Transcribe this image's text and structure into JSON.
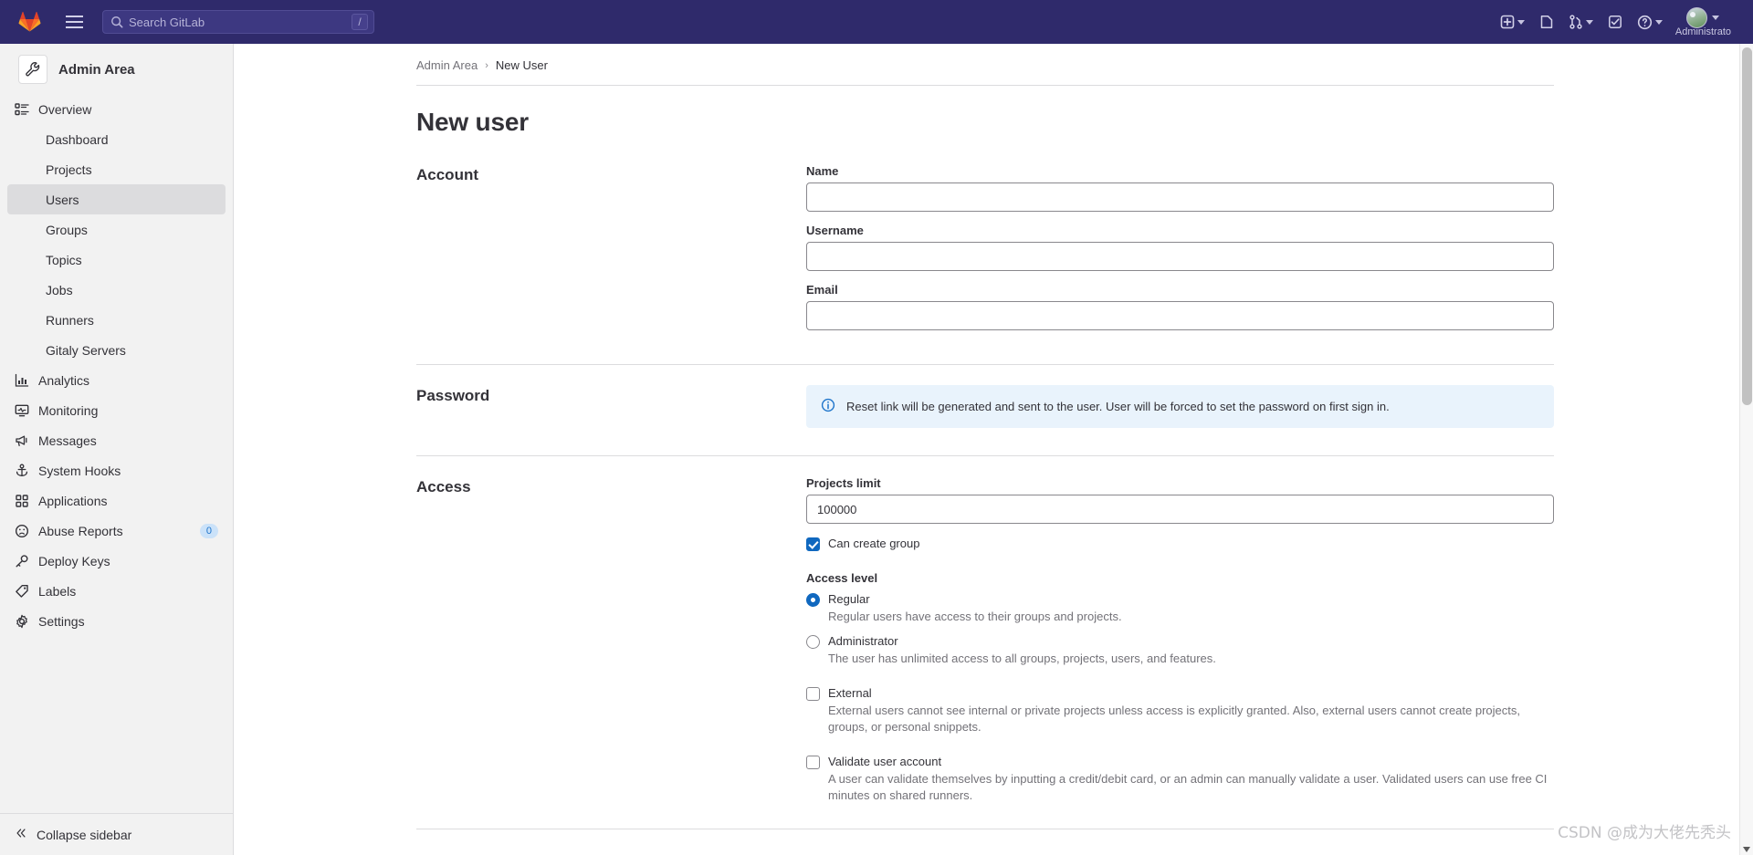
{
  "topbar": {
    "logo_icon": "gitlab-logo-icon",
    "menu_icon": "hamburger-menu-icon",
    "search": {
      "placeholder": "Search GitLab",
      "value": "",
      "shortcut_key": "/",
      "icon": "search-icon"
    },
    "actions": [
      {
        "name": "create-new-menu",
        "icon": "plus-square-icon",
        "has_caret": true
      },
      {
        "name": "issues-link",
        "icon": "issues-icon",
        "has_caret": false
      },
      {
        "name": "merge-requests-menu",
        "icon": "merge-request-icon",
        "has_caret": true
      },
      {
        "name": "todos-link",
        "icon": "todo-checkbox-icon",
        "has_caret": false
      },
      {
        "name": "help-menu",
        "icon": "question-circle-icon",
        "has_caret": true
      }
    ],
    "user": {
      "name": "Administrato",
      "avatar_icon": "user-avatar",
      "has_caret": true
    }
  },
  "sidebar": {
    "context": {
      "label": "Admin Area",
      "icon": "wrench-icon"
    },
    "items": [
      {
        "label": "Overview",
        "icon": "overview-list-icon",
        "level": "top",
        "active": false
      },
      {
        "label": "Dashboard",
        "icon": "",
        "level": "sub",
        "active": false
      },
      {
        "label": "Projects",
        "icon": "",
        "level": "sub",
        "active": false
      },
      {
        "label": "Users",
        "icon": "",
        "level": "sub",
        "active": true
      },
      {
        "label": "Groups",
        "icon": "",
        "level": "sub",
        "active": false
      },
      {
        "label": "Topics",
        "icon": "",
        "level": "sub",
        "active": false
      },
      {
        "label": "Jobs",
        "icon": "",
        "level": "sub",
        "active": false
      },
      {
        "label": "Runners",
        "icon": "",
        "level": "sub",
        "active": false
      },
      {
        "label": "Gitaly Servers",
        "icon": "",
        "level": "sub",
        "active": false
      },
      {
        "label": "Analytics",
        "icon": "chart-icon",
        "level": "top",
        "active": false
      },
      {
        "label": "Monitoring",
        "icon": "monitor-icon",
        "level": "top",
        "active": false
      },
      {
        "label": "Messages",
        "icon": "megaphone-icon",
        "level": "top",
        "active": false
      },
      {
        "label": "System Hooks",
        "icon": "anchor-icon",
        "level": "top",
        "active": false
      },
      {
        "label": "Applications",
        "icon": "apps-grid-icon",
        "level": "top",
        "active": false
      },
      {
        "label": "Abuse Reports",
        "icon": "sad-face-icon",
        "level": "top",
        "active": false,
        "badge": "0"
      },
      {
        "label": "Deploy Keys",
        "icon": "key-icon",
        "level": "top",
        "active": false
      },
      {
        "label": "Labels",
        "icon": "label-tag-icon",
        "level": "top",
        "active": false
      },
      {
        "label": "Settings",
        "icon": "gear-icon",
        "level": "top",
        "active": false
      }
    ],
    "collapse": {
      "label": "Collapse sidebar",
      "icon": "chevron-double-left-icon"
    }
  },
  "breadcrumb": {
    "items": [
      "Admin Area",
      "New User"
    ],
    "separator": "›"
  },
  "page": {
    "title": "New user"
  },
  "form": {
    "account": {
      "heading": "Account",
      "fields": [
        {
          "label": "Name",
          "value": "",
          "placeholder": "",
          "name": "name-field"
        },
        {
          "label": "Username",
          "value": "",
          "placeholder": "",
          "name": "username-field"
        },
        {
          "label": "Email",
          "value": "",
          "placeholder": "",
          "name": "email-field"
        }
      ]
    },
    "password": {
      "heading": "Password",
      "alert": {
        "icon": "info-circle-icon",
        "text": "Reset link will be generated and sent to the user. User will be forced to set the password on first sign in."
      }
    },
    "access": {
      "heading": "Access",
      "projects_limit": {
        "label": "Projects limit",
        "value": "100000"
      },
      "can_create_group": {
        "label": "Can create group",
        "checked": true
      },
      "access_level": {
        "label": "Access level",
        "options": [
          {
            "label": "Regular",
            "description": "Regular users have access to their groups and projects.",
            "selected": true
          },
          {
            "label": "Administrator",
            "description": "The user has unlimited access to all groups, projects, users, and features.",
            "selected": false
          }
        ]
      },
      "external": {
        "label": "External",
        "checked": false,
        "description": "External users cannot see internal or private projects unless access is explicitly granted. Also, external users cannot create projects, groups, or personal snippets."
      },
      "validate_user": {
        "label": "Validate user account",
        "checked": false,
        "description": "A user can validate themselves by inputting a credit/debit card, or an admin can manually validate a user. Validated users can use free CI minutes on shared runners."
      }
    }
  },
  "watermark": {
    "text": "CSDN @成为大佬先秃头"
  },
  "colors": {
    "nav_background": "#2f2a6b",
    "accent_blue": "#1068bf",
    "sidebar_background": "#f2f2f2",
    "alert_info_background": "#e9f3fc"
  }
}
